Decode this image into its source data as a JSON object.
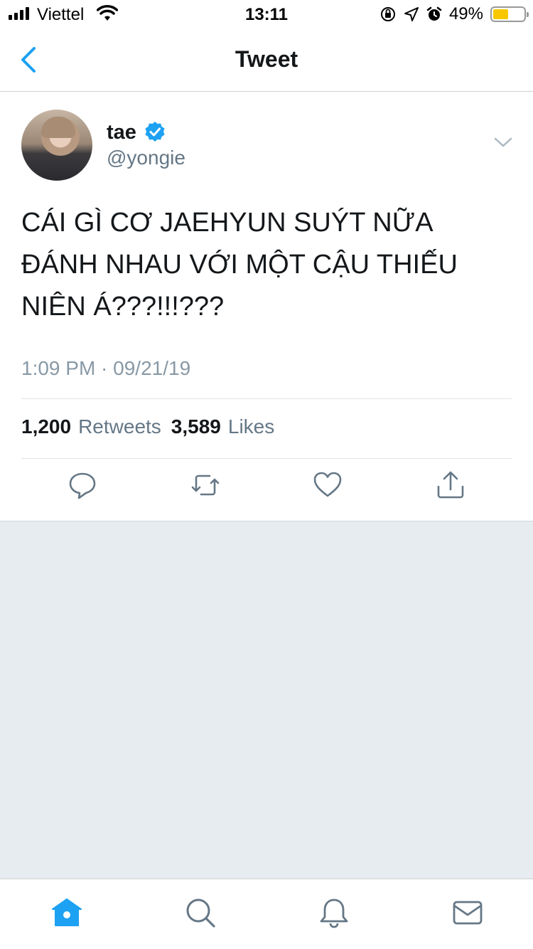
{
  "status_bar": {
    "carrier": "Viettel",
    "time": "13:11",
    "battery_percent": "49%",
    "battery_level": 0.49,
    "icons": [
      "signal-icon",
      "wifi-icon",
      "rotation-lock-icon",
      "location-icon",
      "alarm-icon",
      "battery-icon"
    ]
  },
  "nav": {
    "title": "Tweet",
    "back_icon": "chevron-left-icon"
  },
  "tweet": {
    "author_name": "tae",
    "handle": "@yongie",
    "verified": true,
    "text_lines": [
      "CÁI GÌ CƠ JAEHYUN SUÝT NỮA",
      "ĐÁNH NHAU VỚI MỘT CẬU THIẾU",
      "NIÊN Á???!!!???"
    ],
    "timestamp": "1:09 PM · 09/21/19",
    "retweets_count": "1,200",
    "retweets_label": "Retweets",
    "likes_count": "3,589",
    "likes_label": "Likes",
    "actions": [
      "reply-icon",
      "retweet-icon",
      "like-icon",
      "share-icon"
    ]
  },
  "colors": {
    "accent": "#1da1f2",
    "text_primary": "#14171a",
    "text_secondary": "#657786",
    "background_gray": "#e6ecf0",
    "battery": "#f7c800"
  },
  "tab_bar": {
    "tabs": [
      "home-icon",
      "search-icon",
      "notifications-icon",
      "messages-icon"
    ],
    "active": "home-icon"
  }
}
